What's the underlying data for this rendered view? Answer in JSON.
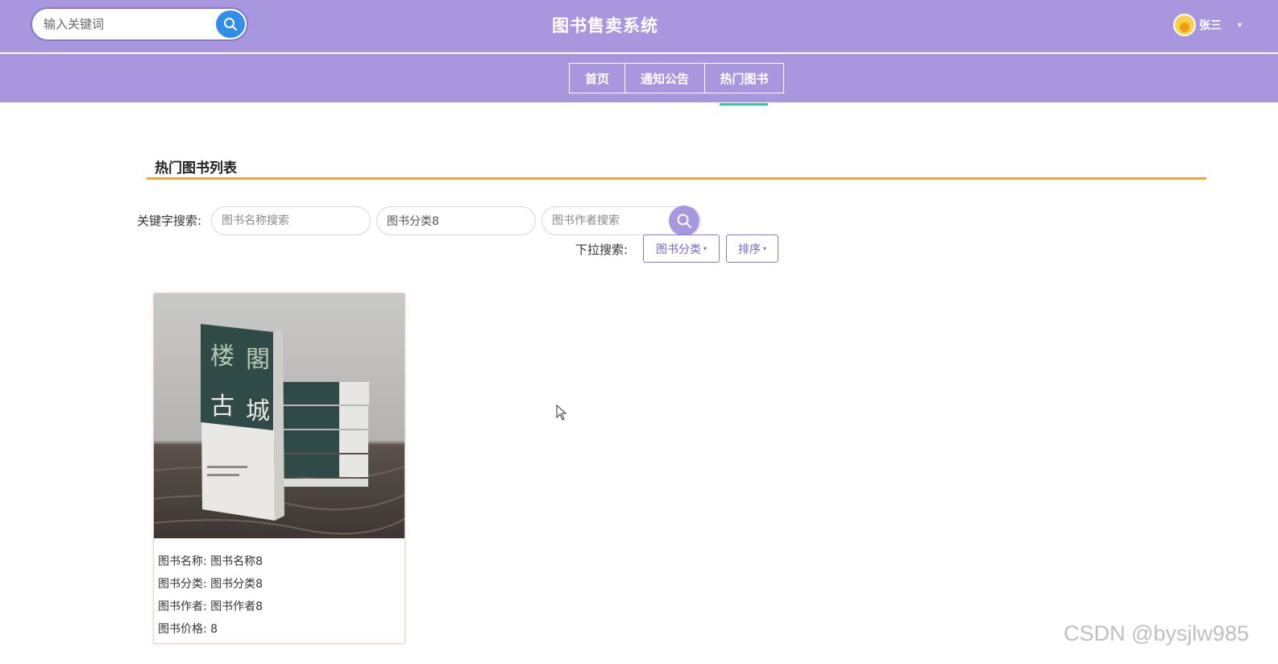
{
  "header": {
    "search_placeholder": "输入关键词",
    "site_title": "图书售卖系统",
    "user_name": "张三",
    "caret": "▾"
  },
  "nav": {
    "items": [
      {
        "label": "首页"
      },
      {
        "label": "通知公告"
      },
      {
        "label": "热门图书"
      }
    ],
    "active": "热门图书"
  },
  "section": {
    "title": "热门图书列表"
  },
  "filters": {
    "keyword_label": "关键字搜索:",
    "name_placeholder": "图书名称搜索",
    "category_value": "图书分类8",
    "author_placeholder": "图书作者搜索",
    "dropdown_label": "下拉搜索:",
    "category_dropdown": "图书分类",
    "sort_dropdown": "排序",
    "caret": "▾"
  },
  "books": [
    {
      "name_row": "图书名称: 图书名称8",
      "category_row": "图书分类: 图书分类8",
      "author_row": "图书作者: 图书作者8",
      "price_row": "图书价格: 8"
    }
  ],
  "watermark": "CSDN @bysjlw985",
  "colors": {
    "header_bg": "#a896de",
    "accent_underline": "#35c3a0",
    "section_line": "#e9a63b",
    "search_button": "#2f8ee8"
  }
}
